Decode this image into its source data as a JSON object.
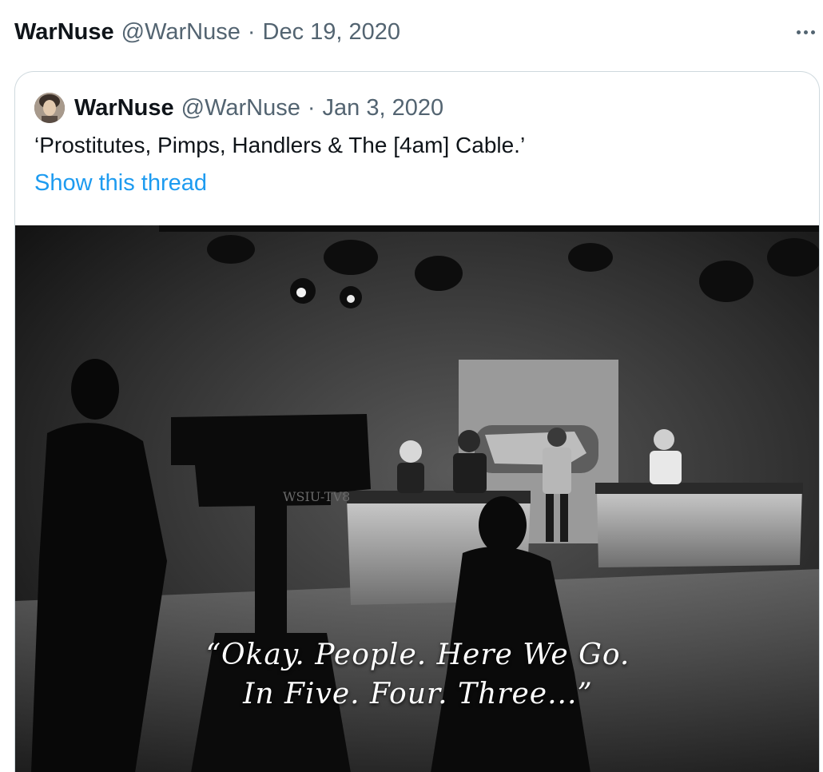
{
  "tweet": {
    "author_name": "WarNuse",
    "author_handle": "@WarNuse",
    "separator": "·",
    "date": "Dec 19, 2020",
    "more_icon": "ellipsis-icon"
  },
  "quoted": {
    "author_name": "WarNuse",
    "author_handle": "@WarNuse",
    "separator": "·",
    "date": "Jan 3, 2020",
    "text": "‘Prostitutes, Pimps, Handlers & The [4am] Cable.’",
    "show_thread": "Show this thread",
    "link_color": "#1d9bf0",
    "image": {
      "camera_label": "WSIU-TV8",
      "caption_line1": "“Okay. People. Here We Go.",
      "caption_line2": "In Five. Four. Three...”"
    }
  }
}
